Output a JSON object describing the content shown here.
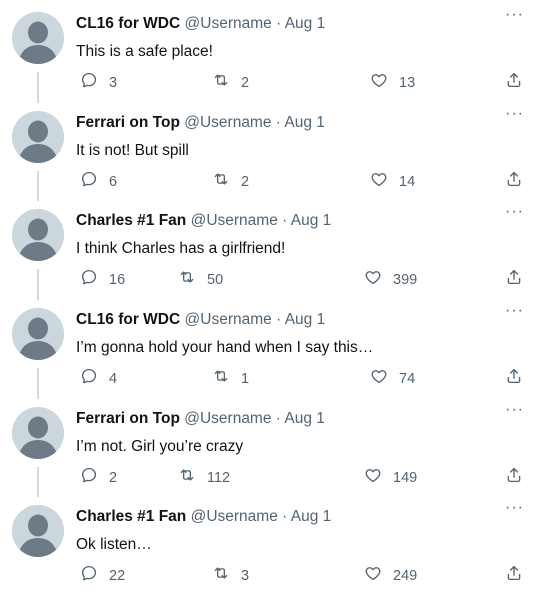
{
  "thread": {
    "tweets": [
      {
        "author": "CL16 for WDC",
        "handle": "@Username",
        "separator": "·",
        "date": "Aug 1",
        "text": "This is a safe place!",
        "replies": "3",
        "retweets": "2",
        "likes": "13"
      },
      {
        "author": "Ferrari on Top",
        "handle": "@Username",
        "separator": "·",
        "date": "Aug 1",
        "text": "It is not! But spill",
        "replies": "6",
        "retweets": "2",
        "likes": "14"
      },
      {
        "author": "Charles #1 Fan",
        "handle": "@Username",
        "separator": "·",
        "date": "Aug 1",
        "text": "I think Charles has a girlfriend!",
        "replies": "16",
        "retweets": "50",
        "likes": "399"
      },
      {
        "author": "CL16 for WDC",
        "handle": "@Username",
        "separator": "·",
        "date": "Aug 1",
        "text": "I’m gonna hold your hand when I say this…",
        "replies": "4",
        "retweets": "1",
        "likes": "74"
      },
      {
        "author": "Ferrari on Top",
        "handle": "@Username",
        "separator": "·",
        "date": "Aug 1",
        "text": "I’m not. Girl you’re crazy",
        "replies": "2",
        "retweets": "112",
        "likes": "149"
      },
      {
        "author": "Charles #1 Fan",
        "handle": "@Username",
        "separator": "·",
        "date": "Aug 1",
        "text": "Ok listen…",
        "replies": "22",
        "retweets": "3",
        "likes": "249"
      }
    ]
  },
  "ui": {
    "more_glyph": "···",
    "icons": {
      "reply": "reply-icon",
      "retweet": "retweet-icon",
      "like": "heart-icon",
      "share": "share-icon",
      "avatar": "default-avatar-icon",
      "more": "more-options-icon"
    },
    "colors": {
      "text": "#0f1419",
      "secondary": "#536471",
      "avatar_bg": "#ccd6dd",
      "avatar_fg": "#6e7b86",
      "connector": "#cfd9de"
    }
  }
}
